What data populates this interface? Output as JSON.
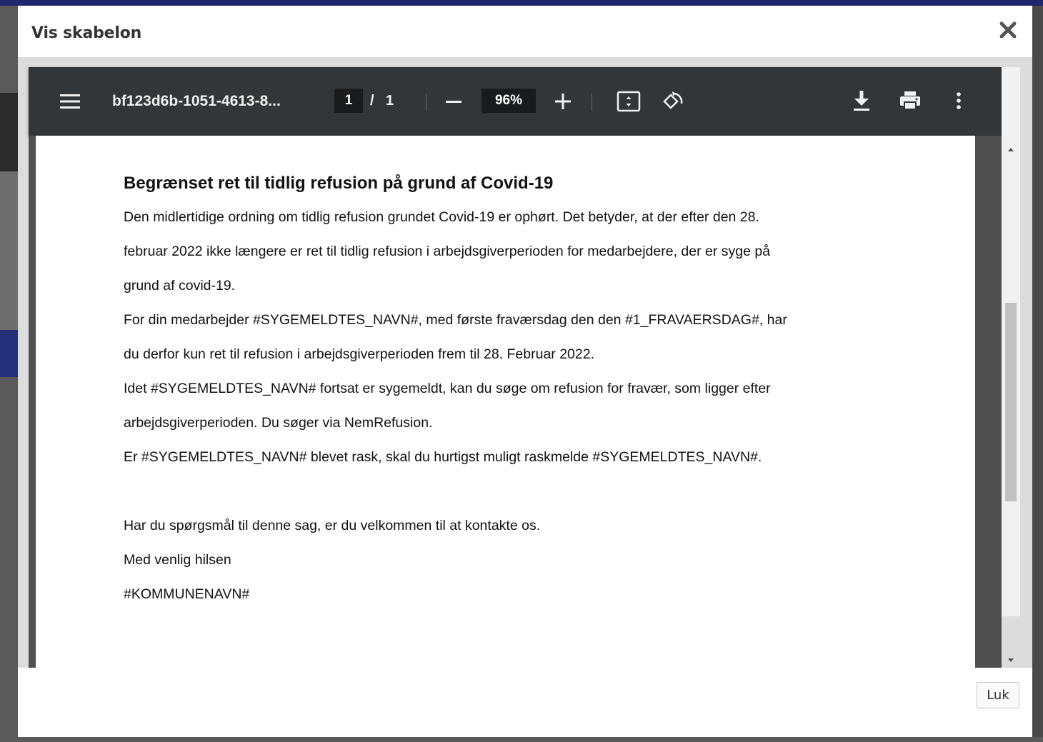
{
  "dialog": {
    "title": "Vis skabelon",
    "close_icon": "close-icon"
  },
  "viewer": {
    "filename": "bf123d6b-1051-4613-8...",
    "page_current": "1",
    "page_separator": "/",
    "page_total": "1",
    "zoom": "96%",
    "icons": [
      "menu-icon",
      "zoom-out-icon",
      "zoom-in-icon",
      "fit-page-icon",
      "rotate-icon",
      "download-icon",
      "print-icon",
      "more-icon"
    ]
  },
  "document": {
    "heading": "Begrænset ret til tidlig refusion på grund af Covid-19",
    "lines": [
      "Den midlertidige ordning om tidlig refusion grundet Covid-19 er ophørt. Det betyder, at der efter den 28.",
      "februar 2022 ikke længere er ret til tidlig refusion i arbejdsgiverperioden for medarbejdere, der er syge på",
      "grund af covid-19.",
      "For din medarbejder #SYGEMELDTES_NAVN#, med første fraværsdag den den #1_FRAVAERSDAG#, har",
      "du derfor kun ret til refusion i arbejdsgiverperioden frem til 28. Februar 2022.",
      "Idet #SYGEMELDTES_NAVN# fortsat er sygemeldt, kan du søge om refusion for fravær, som ligger efter",
      "arbejdsgiverperioden. Du søger via NemRefusion.",
      "Er #SYGEMELDTES_NAVN# blevet rask, skal du hurtigst muligt raskmelde #SYGEMELDTES_NAVN#."
    ],
    "closing": [
      "Har du spørgsmål til denne sag, er du velkommen til at kontakte os.",
      "Med venlig hilsen",
      "#KOMMUNENAVN#"
    ]
  },
  "footer": {
    "close_label": "Luk"
  }
}
